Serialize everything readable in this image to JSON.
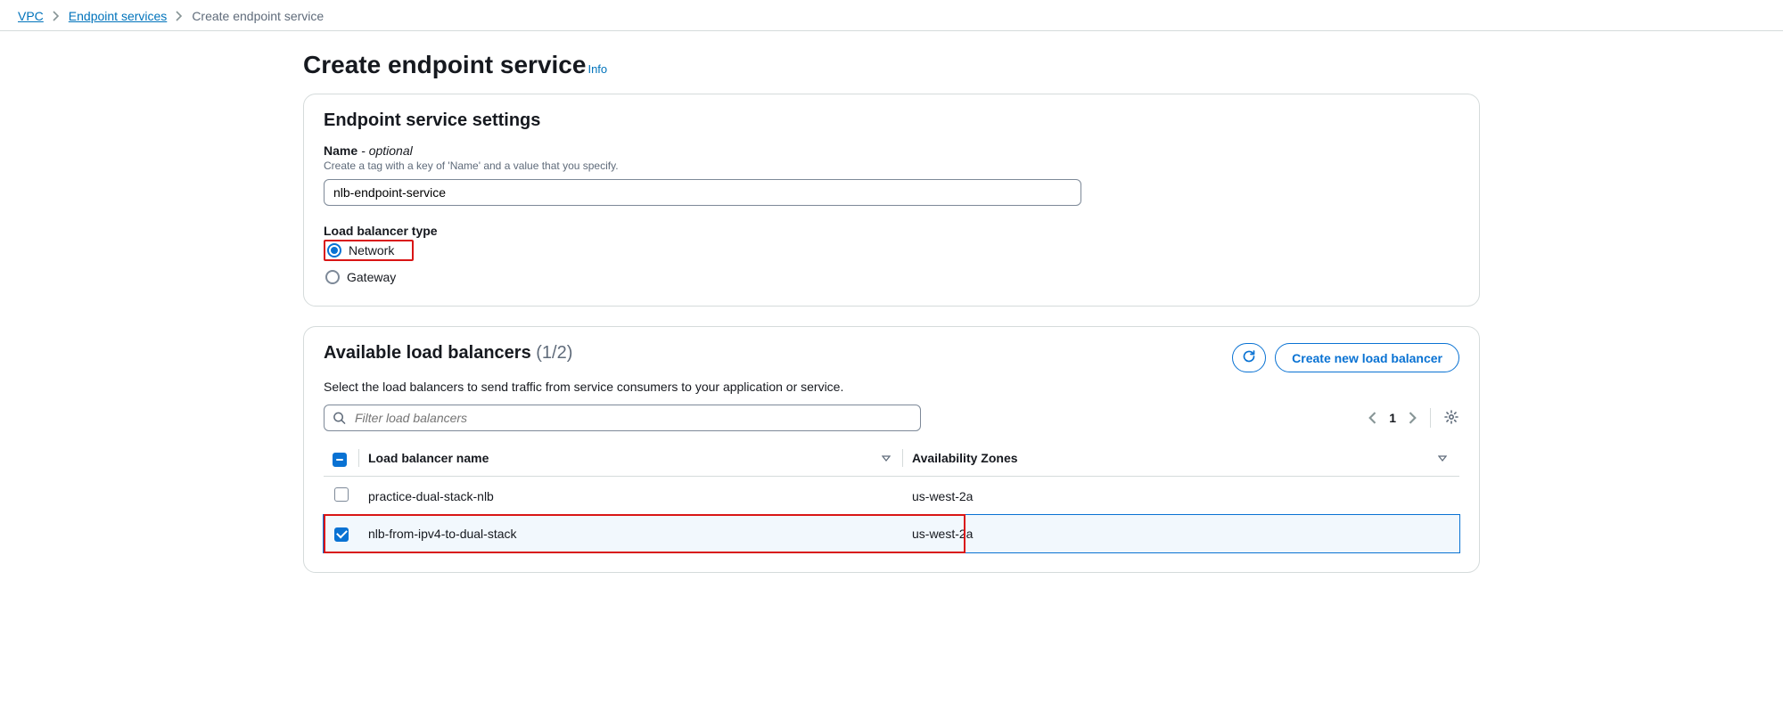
{
  "breadcrumb": {
    "items": [
      {
        "label": "VPC",
        "link": true
      },
      {
        "label": "Endpoint services",
        "link": true
      },
      {
        "label": "Create endpoint service",
        "link": false
      }
    ]
  },
  "page": {
    "title": "Create endpoint service",
    "info_label": "Info"
  },
  "settings_panel": {
    "heading": "Endpoint service settings",
    "name_label": "Name",
    "name_optional": "- optional",
    "name_hint": "Create a tag with a key of 'Name' and a value that you specify.",
    "name_value": "nlb-endpoint-service",
    "lb_type_label": "Load balancer type",
    "radios": {
      "network": "Network",
      "gateway": "Gateway"
    }
  },
  "lb_panel": {
    "heading": "Available load balancers",
    "count": "(1/2)",
    "desc": "Select the load balancers to send traffic from service consumers to your application or service.",
    "refresh_label": "Refresh",
    "create_label": "Create new load balancer",
    "filter_placeholder": "Filter load balancers",
    "pagination": {
      "page": "1"
    },
    "columns": {
      "name": "Load balancer name",
      "az": "Availability Zones"
    },
    "rows": [
      {
        "name": "practice-dual-stack-nlb",
        "az": "us-west-2a",
        "selected": false
      },
      {
        "name": "nlb-from-ipv4-to-dual-stack",
        "az": "us-west-2a",
        "selected": true
      }
    ]
  }
}
